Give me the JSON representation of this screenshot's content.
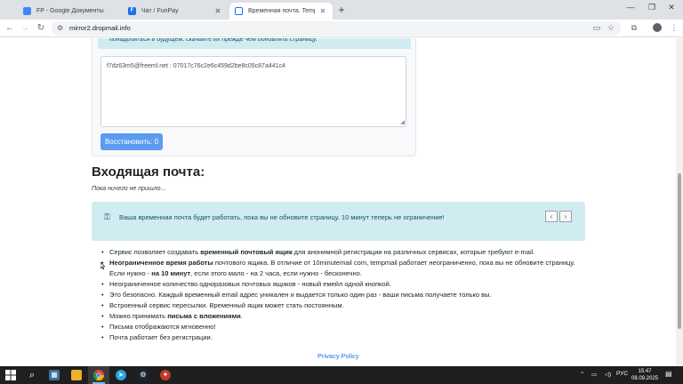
{
  "browser": {
    "tabs": [
      {
        "title": "FP - Google Документы",
        "active": false
      },
      {
        "title": "Чат / FunPay",
        "active": false
      },
      {
        "title": "Временная почта. Temp email",
        "active": true
      }
    ],
    "url": "mirror2.dropmail.info"
  },
  "page": {
    "top_alert_text": "понадобиться в будущем, скачайте их прежде чем обновлять страницу.",
    "restore_textarea_value": "f7dz63m5@freeml.net : 07017c76c2e6c459d2be8c05c87a441c4",
    "restore_button_label": "Восстановить: 0",
    "inbox_title": "Входящая почта:",
    "inbox_empty": "Пока ничего не пришло...",
    "info_alert_text": "Ваша временная почта будет работать, пока вы не обновите страницу. 10 минут теперь не ограничение!",
    "pager_prev": "‹",
    "pager_next": "›",
    "features": {
      "f1_pre": "Сервис позволяет создавать ",
      "f1_bold": "временный почтовый ящик",
      "f1_post": " для анонимной регистрации на различных сервисах, которые требуют e-mail.",
      "f2_bold": "Неограниченное время работы",
      "f2_mid": " почтового ящика. В отличие от 10minutemail com, tempmail работает неограниченно, пока вы не обновите страницу. Если нужно - ",
      "f2_bold2": "на 10 минут",
      "f2_post": ", если этого мало - на 2 часа, если нужно - бесконечно.",
      "f3": "Неограниченное количество одноразовых почтовых ящиков - новый емейл одной кнопкой.",
      "f4": "Это безопасно. Каждый временный email адрес уникален и выдается только один раз - ваши письма получаете только вы.",
      "f5": "Встроенный сервис пересылки. Временный ящик может стать постоянным.",
      "f6_pre": "Можно принимать ",
      "f6_bold": "письма с вложениями",
      "f6_post": ".",
      "f7": "Письма отображаются мгновенно!",
      "f8": "Почта работает без регистрации."
    },
    "footer_link": "Privacy Policy"
  },
  "taskbar": {
    "language": "РУС",
    "time": "15:47",
    "date": "08.09.2025"
  },
  "colors": {
    "alert_bg": "#d1ecf1",
    "alert_text": "#0c5460",
    "button_bg": "#5a9cf2",
    "link": "#1a73e8"
  }
}
